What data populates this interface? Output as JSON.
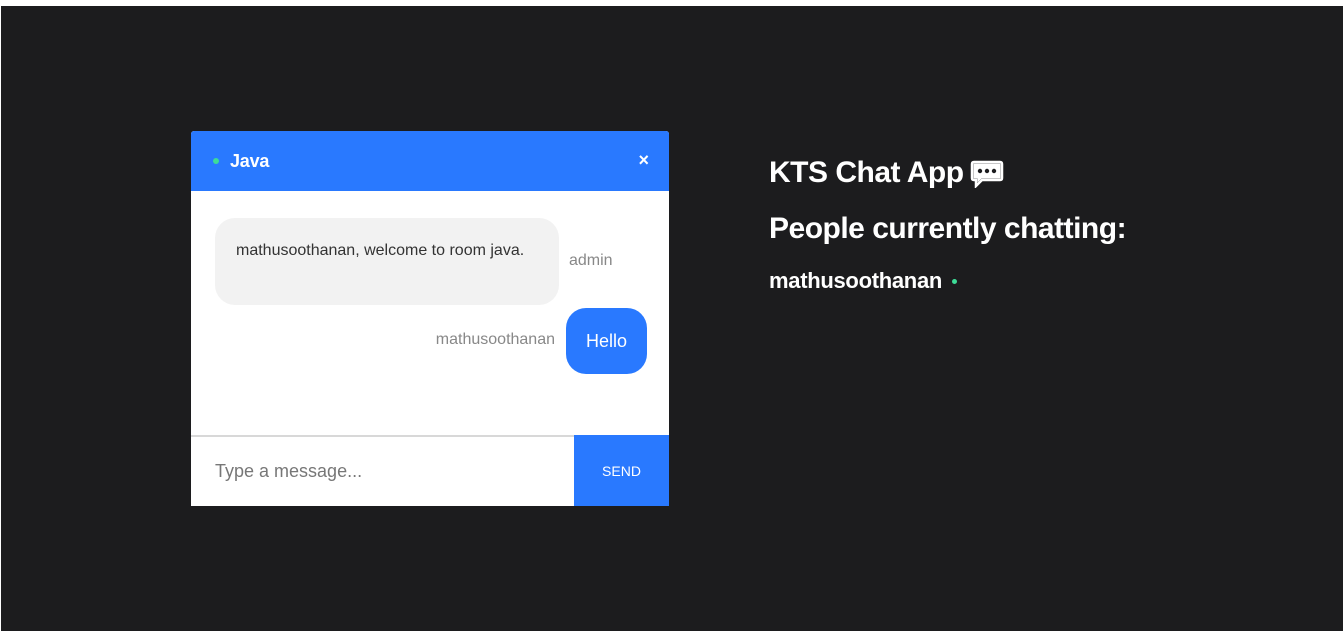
{
  "chat": {
    "room_name": "Java",
    "close_label": "×",
    "messages": [
      {
        "sender": "admin",
        "text": "mathusoothanan, welcome to room java."
      },
      {
        "sender": "mathusoothanan",
        "text": "Hello"
      }
    ],
    "input_placeholder": "Type a message...",
    "send_label": "SEND"
  },
  "side": {
    "app_title": "KTS Chat App",
    "people_heading": "People currently chatting:",
    "users": [
      "mathusoothanan"
    ]
  },
  "colors": {
    "background": "#1c1c1e",
    "accent": "#2979ff",
    "online": "#3ddc97",
    "bubble_other": "#f2f2f2"
  },
  "icons": {
    "title_icon": "speech-bubble-icon",
    "status_icon": "online-dot-icon"
  }
}
